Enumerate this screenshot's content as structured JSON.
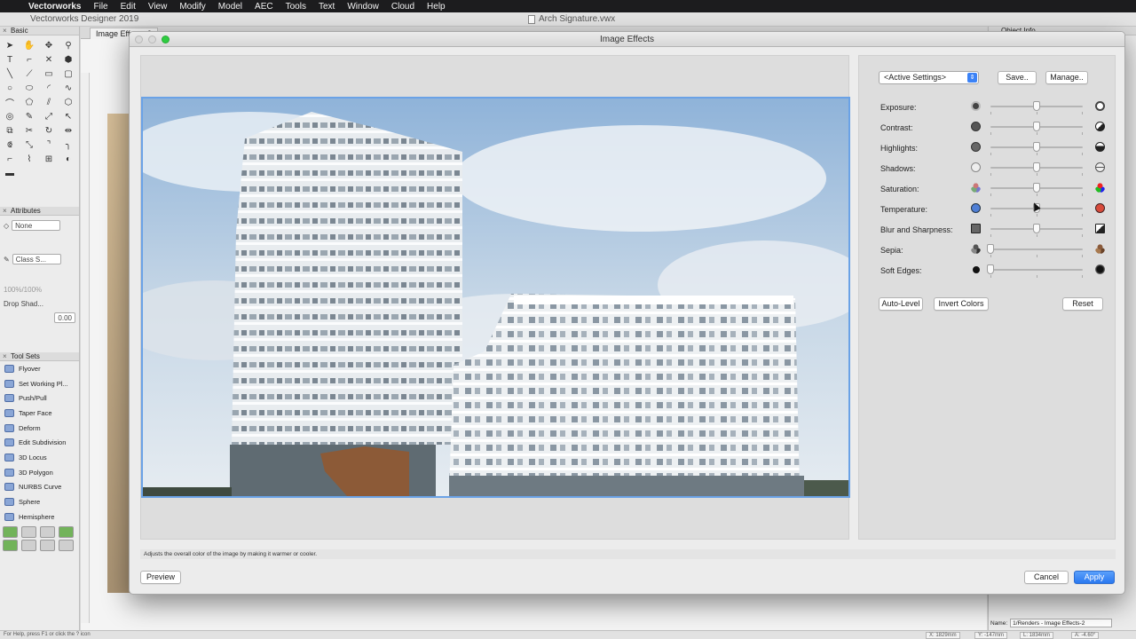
{
  "menubar": {
    "app": "Vectorworks",
    "items": [
      "File",
      "Edit",
      "View",
      "Modify",
      "Model",
      "AEC",
      "Tools",
      "Text",
      "Window",
      "Cloud",
      "Help"
    ]
  },
  "app_window": {
    "title": "Vectorworks Designer 2019",
    "document": "Arch Signature.vwx"
  },
  "left_palettes": {
    "basic_title": "Basic",
    "attributes_title": "Attributes",
    "fill_value": "None",
    "pen_value": "Class S...",
    "opacity": "100%/100%",
    "drop_shadow": "Drop Shad...",
    "line_value": "0.00",
    "toolsets_title": "Tool Sets",
    "toolsets": [
      "Flyover",
      "Set Working Pl...",
      "Push/Pull",
      "Taper Face",
      "Deform",
      "Edit Subdivision",
      "3D Locus",
      "3D Polygon",
      "NURBS Curve",
      "Sphere",
      "Hemisphere"
    ]
  },
  "canvas": {
    "tab": "Image Effects-2"
  },
  "right_palette": {
    "title": "Object Info",
    "name_label": "Name:",
    "name_value": "1/Renders - Image Effects-2"
  },
  "status": {
    "help": "For Help, press F1 or click the ? icon",
    "x": "X: 1829mm",
    "y": "Y: -147mm",
    "l": "L: 1834mm",
    "a": "A: -4.60°"
  },
  "dialog": {
    "title": "Image Effects",
    "settings_popup": "<Active Settings>",
    "save_label": "Save..",
    "manage_label": "Manage..",
    "sliders": [
      {
        "label": "Exposure:",
        "value": 0.5
      },
      {
        "label": "Contrast:",
        "value": 0.5
      },
      {
        "label": "Highlights:",
        "value": 0.5
      },
      {
        "label": "Shadows:",
        "value": 0.5
      },
      {
        "label": "Saturation:",
        "value": 0.5
      },
      {
        "label": "Temperature:",
        "value": 0.5
      },
      {
        "label": "Blur and Sharpness:",
        "value": 0.5
      },
      {
        "label": "Sepia:",
        "value": 0.0
      },
      {
        "label": "Soft Edges:",
        "value": 0.0
      }
    ],
    "auto_level_label": "Auto-Level",
    "invert_label": "Invert Colors",
    "reset_label": "Reset",
    "hint": "Adjusts the overall color of the image by making it warmer or cooler.",
    "preview_label": "Preview",
    "cancel_label": "Cancel",
    "apply_label": "Apply"
  },
  "colors": {
    "accent": "#2a78f0",
    "selection_border": "#6aa2e6"
  }
}
